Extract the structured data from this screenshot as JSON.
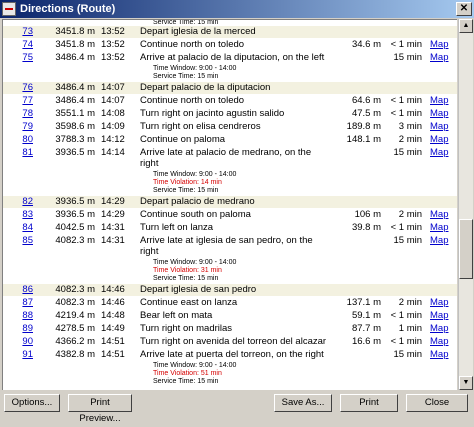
{
  "window": {
    "title": "Directions (Route)"
  },
  "header_partial": {
    "note_text": "Service Time: 15 min"
  },
  "rows": [
    {
      "num": "73",
      "dist": "3451.8 m",
      "time": "13:52",
      "desc": "Depart iglesia de la merced",
      "seg": "",
      "dur": "",
      "map": ""
    },
    {
      "num": "74",
      "dist": "3451.8 m",
      "time": "13:52",
      "desc": "Continue north on toledo",
      "seg": "34.6 m",
      "dur": "< 1 min",
      "map": "Map"
    },
    {
      "num": "75",
      "dist": "3486.4 m",
      "time": "13:52",
      "desc": "Arrive at palacio de la diputacion, on the left",
      "seg": "",
      "dur": "15 min",
      "map": "Map"
    },
    {
      "num": "76",
      "dist": "3486.4 m",
      "time": "14:07",
      "desc": "Depart palacio de la diputacion",
      "seg": "",
      "dur": "",
      "map": ""
    },
    {
      "num": "77",
      "dist": "3486.4 m",
      "time": "14:07",
      "desc": "Continue north on toledo",
      "seg": "64.6 m",
      "dur": "< 1 min",
      "map": "Map"
    },
    {
      "num": "78",
      "dist": "3551.1 m",
      "time": "14:08",
      "desc": "Turn right on jacinto agustin salido",
      "seg": "47.5 m",
      "dur": "< 1 min",
      "map": "Map"
    },
    {
      "num": "79",
      "dist": "3598.6 m",
      "time": "14:09",
      "desc": "Turn right on elisa cendreros",
      "seg": "189.8 m",
      "dur": "3 min",
      "map": "Map"
    },
    {
      "num": "80",
      "dist": "3788.3 m",
      "time": "14:12",
      "desc": "Continue on paloma",
      "seg": "148.1 m",
      "dur": "2 min",
      "map": "Map"
    },
    {
      "num": "81",
      "dist": "3936.5 m",
      "time": "14:14",
      "desc": "Arrive late at palacio de medrano, on the",
      "desc2": "right",
      "seg": "",
      "dur": "15 min",
      "map": "Map"
    },
    {
      "num": "82",
      "dist": "3936.5 m",
      "time": "14:29",
      "desc": "Depart palacio de medrano",
      "seg": "",
      "dur": "",
      "map": ""
    },
    {
      "num": "83",
      "dist": "3936.5 m",
      "time": "14:29",
      "desc": "Continue south on paloma",
      "seg": "106 m",
      "dur": "2 min",
      "map": "Map"
    },
    {
      "num": "84",
      "dist": "4042.5 m",
      "time": "14:31",
      "desc": "Turn left on lanza",
      "seg": "39.8 m",
      "dur": "< 1 min",
      "map": "Map"
    },
    {
      "num": "85",
      "dist": "4082.3 m",
      "time": "14:31",
      "desc": "Arrive late at iglesia de san pedro, on the",
      "desc2": "right",
      "seg": "",
      "dur": "15 min",
      "map": "Map"
    },
    {
      "num": "86",
      "dist": "4082.3 m",
      "time": "14:46",
      "desc": "Depart iglesia de san pedro",
      "seg": "",
      "dur": "",
      "map": ""
    },
    {
      "num": "87",
      "dist": "4082.3 m",
      "time": "14:46",
      "desc": "Continue east on lanza",
      "seg": "137.1 m",
      "dur": "2 min",
      "map": "Map"
    },
    {
      "num": "88",
      "dist": "4219.4 m",
      "time": "14:48",
      "desc": "Bear left on mata",
      "seg": "59.1 m",
      "dur": "< 1 min",
      "map": "Map"
    },
    {
      "num": "89",
      "dist": "4278.5 m",
      "time": "14:49",
      "desc": "Turn right on madrilas",
      "seg": "87.7 m",
      "dur": "1 min",
      "map": "Map"
    },
    {
      "num": "90",
      "dist": "4366.2 m",
      "time": "14:51",
      "desc": "Turn right on avenida del torreon del alcazar",
      "seg": "16.6 m",
      "dur": "< 1 min",
      "map": "Map"
    },
    {
      "num": "91",
      "dist": "4382.8 m",
      "time": "14:51",
      "desc": "Arrive late at puerta del torreon, on the right",
      "seg": "",
      "dur": "15 min",
      "map": "Map"
    }
  ],
  "notes": {
    "r75": [
      "Time Window: 9:00 - 14:00",
      "Service Time: 15 min"
    ],
    "r81": [
      "Time Window: 9:00 - 14:00",
      "Time Violation: 14 min",
      "Service Time: 15 min"
    ],
    "r85": [
      "Time Window: 9:00 - 14:00",
      "Time Violation: 31 min",
      "Service Time: 15 min"
    ],
    "r91": [
      "Time Window: 9:00 - 14:00",
      "Time Violation: 51 min",
      "Service Time: 15 min"
    ]
  },
  "buttons": {
    "options": "Options...",
    "print_preview": "Print Preview...",
    "save_as": "Save As...",
    "print": "Print",
    "close": "Close"
  },
  "colors": {
    "link": "#0000cc",
    "violation": "#d40000",
    "alt_row": "#f3f1e0"
  }
}
